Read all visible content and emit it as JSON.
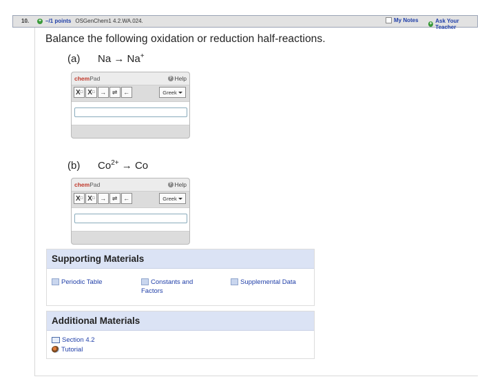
{
  "question": {
    "number": "10.",
    "points": "–/1 points",
    "course_code": "OSGenChem1 4.2.WA.024.",
    "my_notes": "My Notes",
    "ask_teacher": "Ask Your Teacher",
    "instruction": "Balance the following oxidation or reduction half-reactions."
  },
  "parts": [
    {
      "label": "(a)",
      "reactant": "Na",
      "reactant_sup": "",
      "arrow": "→",
      "product": "Na",
      "product_sup": "+"
    },
    {
      "label": "(b)",
      "reactant": "Co",
      "reactant_sup": "2+",
      "arrow": "→",
      "product": "Co",
      "product_sup": ""
    }
  ],
  "chempad": {
    "title_chem": "chem",
    "title_pad": "Pad",
    "help": "Help",
    "greek": "Greek",
    "tools": [
      "X",
      "X",
      "→",
      "⇌",
      "←"
    ],
    "tool_sub": "□",
    "tool_sup": "□"
  },
  "supporting": {
    "title": "Supporting Materials",
    "links": [
      "Periodic Table",
      "Constants and Factors",
      "Supplemental Data"
    ]
  },
  "additional": {
    "title": "Additional Materials",
    "links": [
      "Section 4.2",
      "Tutorial"
    ]
  },
  "colors": {
    "accent_link": "#1f3ea8",
    "chem_red": "#c0392b",
    "panel_header": "#dbe3f5",
    "plus_green": "#3a9a3a"
  }
}
